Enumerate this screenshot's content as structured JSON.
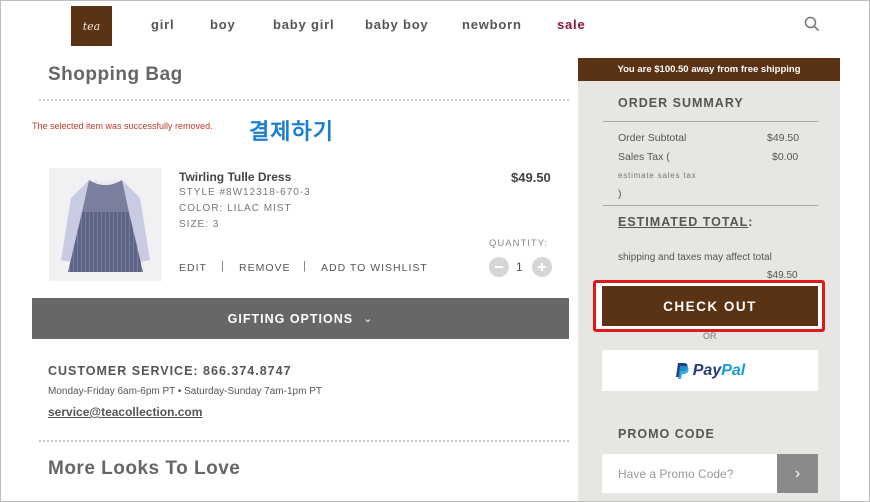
{
  "header": {
    "logo_text": "tea",
    "nav": [
      {
        "label": "girl",
        "sale": false
      },
      {
        "label": "boy",
        "sale": false
      },
      {
        "label": "baby girl",
        "sale": false
      },
      {
        "label": "baby boy",
        "sale": false
      },
      {
        "label": "newborn",
        "sale": false
      },
      {
        "label": "sale",
        "sale": true
      }
    ],
    "search_icon": "search-icon"
  },
  "bag": {
    "title": "Shopping Bag",
    "message": "The selected item was successfully removed.",
    "overlay_text": "결제하기"
  },
  "item": {
    "name": "Twirling Tulle Dress",
    "style": "STYLE #8W12318-670-3",
    "color": "COLOR: LILAC MIST",
    "size": "SIZE: 3",
    "price": "$49.50",
    "quantity_label": "QUANTITY:",
    "quantity": "1",
    "actions": {
      "edit": "EDIT",
      "remove": "REMOVE",
      "wishlist": "ADD TO WISHLIST",
      "separator": "|"
    }
  },
  "gifting": {
    "label": "GIFTING OPTIONS",
    "chevron": "⌄"
  },
  "customer_service": {
    "title": "CUSTOMER SERVICE:  866.374.8747",
    "hours": "Monday-Friday 6am-6pm PT • Saturday-Sunday 7am-1pm PT",
    "email": "service@teacollection.com"
  },
  "more_looks": {
    "title": "More Looks To Love"
  },
  "summary": {
    "shipping_banner": "You are $100.50 away from free shipping",
    "title": "ORDER SUMMARY",
    "subtotal_label": "Order Subtotal",
    "subtotal_value": "$49.50",
    "tax_label": "Sales Tax (",
    "tax_value": "$0.00",
    "tax_link": "estimate sales tax",
    "tax_close": ")",
    "estimated_label": "ESTIMATED TOTAL",
    "estimated_colon": ":",
    "affect_note": "shipping and taxes may affect total",
    "estimated_value": "$49.50",
    "checkout_label": "CHECK OUT",
    "or_label": "OR",
    "paypal_pay": "Pay",
    "paypal_pal": "Pal",
    "promo_title": "PROMO CODE",
    "promo_placeholder": "Have a Promo Code?",
    "promo_arrow": "›"
  },
  "colors": {
    "brand_brown": "#5a3214",
    "sale": "#8b1538",
    "highlight_red": "#e11919",
    "panel_bg": "#e8e6e3",
    "gift_bar": "#676767"
  }
}
